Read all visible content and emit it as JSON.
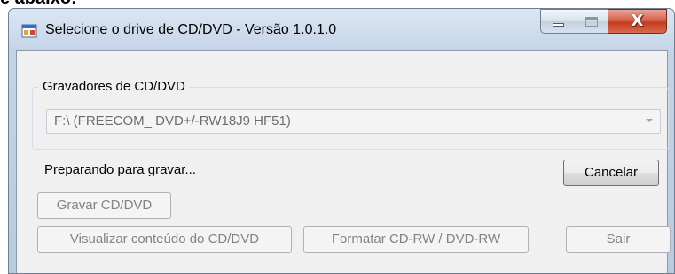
{
  "background_text": "e abaixo:",
  "window": {
    "title": "Selecione o drive de CD/DVD - Versão 1.0.1.0",
    "icon": "app-window-icon",
    "caption_buttons": {
      "minimize_icon": "minimize-icon",
      "maximize_icon": "maximize-icon",
      "close_glyph": "X"
    }
  },
  "group": {
    "label": "Gravadores de CD/DVD",
    "drive_select": {
      "value": "F:\\ (FREECOM_ DVD+/-RW18J9 HF51)",
      "enabled": false
    }
  },
  "status_text": "Preparando para gravar...",
  "buttons": {
    "cancel": {
      "label": "Cancelar",
      "enabled": true
    },
    "burn": {
      "label": "Gravar CD/DVD",
      "enabled": false
    },
    "view": {
      "label": "Visualizar conteúdo do CD/DVD",
      "enabled": false
    },
    "format": {
      "label": "Formatar CD-RW / DVD-RW",
      "enabled": false
    },
    "exit": {
      "label": "Sair",
      "enabled": false
    }
  },
  "colors": {
    "close_button": "#c43b1f",
    "disabled_text": "#838383",
    "client_background": "#f0f0f0"
  }
}
